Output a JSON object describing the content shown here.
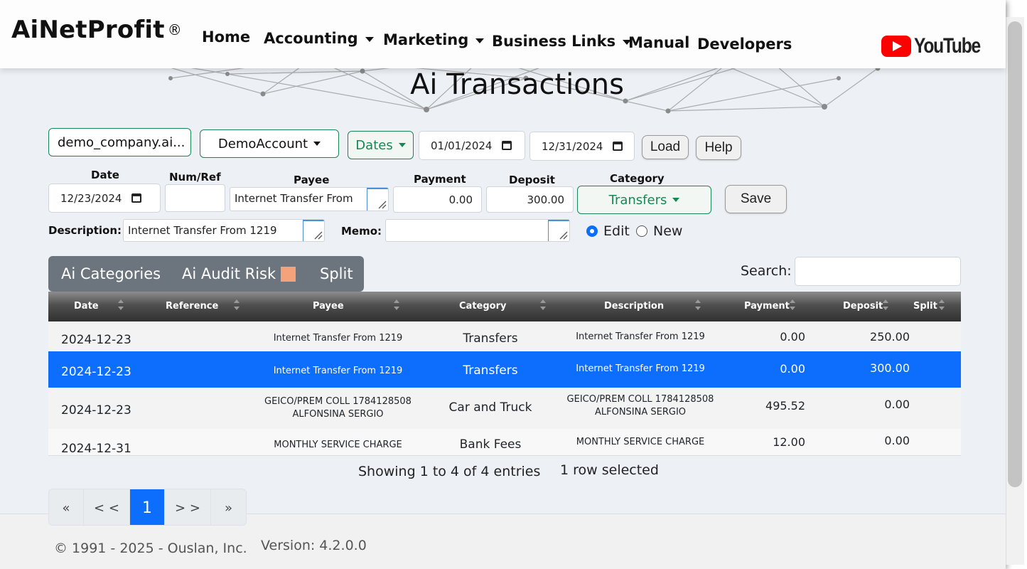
{
  "nav": {
    "brand": "AiNetProfit",
    "reg": "®",
    "home": "Home",
    "accounting": "Accounting",
    "marketing": "Marketing",
    "business_links": "Business Links",
    "manual": "Manual",
    "developers": "Developers",
    "youtube": "YouTube"
  },
  "page": {
    "title": "Ai Transactions"
  },
  "toolbar": {
    "company": "demo_company.ai...",
    "account": "DemoAccount",
    "dates": "Dates",
    "start_date": "01/01/2024",
    "end_date": "12/31/2024",
    "load": "Load",
    "help": "Help"
  },
  "form": {
    "date_label": "Date",
    "date_value": "12/23/2024",
    "numref_label": "Num/Ref",
    "numref_value": "",
    "payee_label": "Payee",
    "payee_value": "Internet Transfer From",
    "payment_label": "Payment",
    "payment_value": "0.00",
    "deposit_label": "Deposit",
    "deposit_value": "300.00",
    "category_label": "Category",
    "category_value": "Transfers",
    "save": "Save",
    "description_label": "Description:",
    "description_value": "Internet Transfer From 1219",
    "memo_label": "Memo:",
    "memo_value": "",
    "edit_label": "Edit",
    "new_label": "New",
    "mode": "edit"
  },
  "tabs": {
    "ai_categories": "Ai Categories",
    "ai_audit_risk": "Ai Audit Risk",
    "split": "Split",
    "risk_color": "#f4a27a"
  },
  "search": {
    "label": "Search:",
    "value": ""
  },
  "table": {
    "headers": [
      "Date",
      "Reference",
      "Payee",
      "Category",
      "Description",
      "Payment",
      "Deposit",
      "Split"
    ],
    "rows": [
      {
        "date": "2024-12-23",
        "reference": "",
        "payee1": "Internet Transfer From 1219",
        "payee2": "",
        "category": "Transfers",
        "desc1": "Internet Transfer From 1219",
        "desc2": "",
        "payment": "0.00",
        "deposit": "250.00",
        "split": ""
      },
      {
        "date": "2024-12-23",
        "reference": "",
        "payee1": "Internet Transfer From 1219",
        "payee2": "",
        "category": "Transfers",
        "desc1": "Internet Transfer From 1219",
        "desc2": "",
        "payment": "0.00",
        "deposit": "300.00",
        "split": ""
      },
      {
        "date": "2024-12-23",
        "reference": "",
        "payee1": "GEICO/PREM COLL 1784128508",
        "payee2": "ALFONSINA SERGIO",
        "category": "Car and Truck",
        "desc1": "GEICO/PREM COLL 1784128508",
        "desc2": "ALFONSINA SERGIO",
        "payment": "495.52",
        "deposit": "0.00",
        "split": ""
      },
      {
        "date": "2024-12-31",
        "reference": "",
        "payee1": "MONTHLY SERVICE CHARGE",
        "payee2": "",
        "category": "Bank Fees",
        "desc1": "MONTHLY SERVICE CHARGE",
        "desc2": "",
        "payment": "12.00",
        "deposit": "0.00",
        "split": ""
      }
    ],
    "selected_index": 1,
    "showing": "Showing 1 to 4 of 4 entries",
    "selected_text": "1 row selected"
  },
  "pager": {
    "first": "«",
    "prev": "< <",
    "current": "1",
    "next": "> >",
    "last": "»"
  },
  "footer": {
    "copyright": "© 1991 - 2025 - Ouslan, Inc.",
    "version": "Version: 4.2.0.0"
  },
  "colors": {
    "accent": "#0d6efd",
    "green": "#198754",
    "header_dark": "#303030"
  }
}
